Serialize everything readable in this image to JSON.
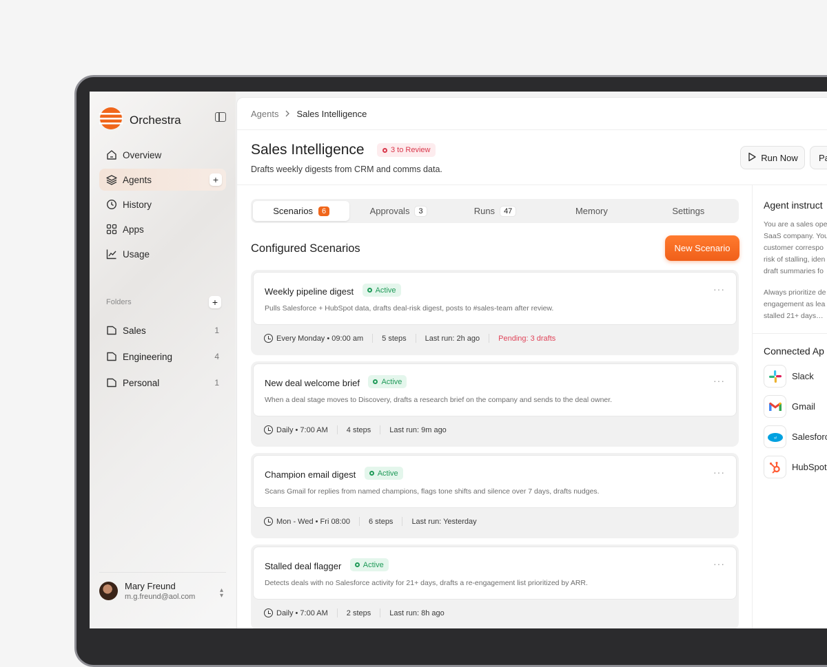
{
  "sidebar": {
    "brand": "Orchestra",
    "nav": [
      {
        "label": "Overview",
        "icon": "home-icon"
      },
      {
        "label": "Agents",
        "icon": "layers-icon",
        "active": true
      },
      {
        "label": "History",
        "icon": "history-icon"
      },
      {
        "label": "Apps",
        "icon": "grid-icon"
      },
      {
        "label": "Usage",
        "icon": "chart-line-icon"
      }
    ],
    "folders_label": "Folders",
    "folders": [
      {
        "label": "Sales",
        "count": "1"
      },
      {
        "label": "Engineering",
        "count": "4"
      },
      {
        "label": "Personal",
        "count": "1"
      }
    ],
    "user": {
      "name": "Mary Freund",
      "email": "m.g.freund@aol.com"
    }
  },
  "breadcrumb": {
    "parent": "Agents",
    "current": "Sales Intelligence"
  },
  "header": {
    "title": "Sales Intelligence",
    "review_badge": "3 to Review",
    "subtitle": "Drafts weekly digests from CRM and comms data.",
    "run_label": "Run Now",
    "pause_label": "Pa"
  },
  "tabs": [
    {
      "label": "Scenarios",
      "count": "6"
    },
    {
      "label": "Approvals",
      "count": "3"
    },
    {
      "label": "Runs",
      "count": "47"
    },
    {
      "label": "Memory",
      "count": ""
    },
    {
      "label": "Settings",
      "count": ""
    }
  ],
  "scenarios_title": "Configured Scenarios",
  "new_scenario_label": "New Scenario",
  "status_active": "Active",
  "scenarios": [
    {
      "title": "Weekly pipeline digest",
      "desc": "Pulls Salesforce + HubSpot data, drafts deal-risk digest, posts to #sales-team after review.",
      "schedule": "Every Monday • 09:00 am",
      "steps": "5 steps",
      "last_run": "Last run: 2h ago",
      "pending": "Pending: 3 drafts"
    },
    {
      "title": "New deal welcome brief",
      "desc": "When a deal stage moves to Discovery, drafts a research brief on the company and sends to the deal owner.",
      "schedule": "Daily • 7:00 AM",
      "steps": "4 steps",
      "last_run": "Last run: 9m ago",
      "pending": ""
    },
    {
      "title": "Champion email digest",
      "desc": "Scans Gmail for replies from named champions, flags tone shifts and silence over 7 days, drafts nudges.",
      "schedule": "Mon - Wed • Fri 08:00",
      "steps": "6 steps",
      "last_run": "Last run: Yesterday",
      "pending": ""
    },
    {
      "title": "Stalled deal flagger",
      "desc": "Detects deals with no Salesforce activity for 21+ days, drafts a re-engagement list prioritized by ARR.",
      "schedule": "Daily • 7:00 AM",
      "steps": "2 steps",
      "last_run": "Last run: 8h ago",
      "pending": ""
    }
  ],
  "right_panel": {
    "instructions_title": "Agent instruct",
    "instructions_lines": [
      "You are a sales oper",
      "SaaS company. You",
      "customer correspo",
      "risk of stalling, iden",
      "draft summaries fo"
    ],
    "instructions_lines2": [
      "Always prioritize de",
      "engagement as lea",
      "stalled 21+ days…"
    ],
    "apps_title": "Connected Ap",
    "apps": [
      {
        "label": "Slack",
        "icon": "slack-icon"
      },
      {
        "label": "Gmail",
        "icon": "gmail-icon"
      },
      {
        "label": "Salesforc",
        "icon": "salesforce-icon"
      },
      {
        "label": "HubSpot",
        "icon": "hubspot-icon"
      }
    ]
  },
  "colors": {
    "accent": "#f0661b",
    "active_green": "#1f9a58",
    "pending_red": "#e0455a"
  }
}
